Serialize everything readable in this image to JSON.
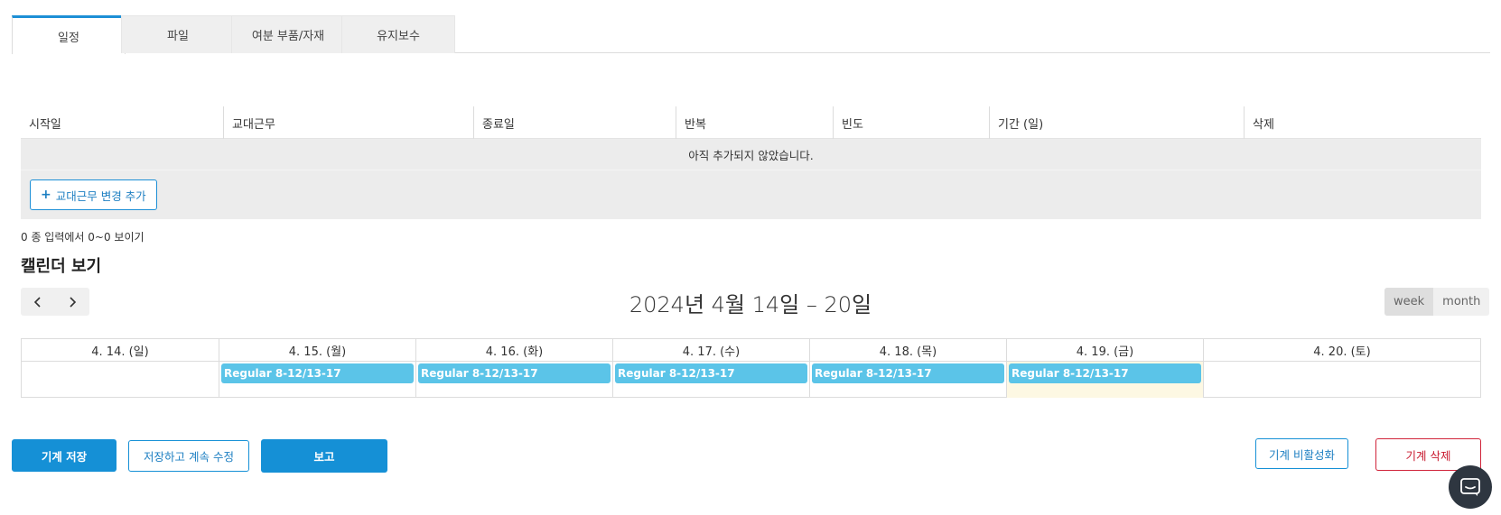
{
  "tabs": [
    {
      "label": "일정",
      "active": true
    },
    {
      "label": "파일",
      "active": false
    },
    {
      "label": "여분 부품/자재",
      "active": false
    },
    {
      "label": "유지보수",
      "active": false
    }
  ],
  "shift_table": {
    "columns": [
      "시작일",
      "교대근무",
      "종료일",
      "반복",
      "빈도",
      "기간 (일)",
      "삭제"
    ],
    "empty_message": "아직 추가되지 않았습니다.",
    "add_button_label": "교대근무 변경 추가",
    "entries_text": "0 종 입력에서 0~0 보이기"
  },
  "calendar": {
    "title": "캘린더 보기",
    "range_title": "2024년 4월 14일 – 20일",
    "views": [
      {
        "label": "week",
        "active": true
      },
      {
        "label": "month",
        "active": false
      }
    ],
    "days": [
      {
        "label": "4. 14. (일)",
        "event": null,
        "today": false
      },
      {
        "label": "4. 15. (월)",
        "event": "Regular 8-12/13-17",
        "today": false
      },
      {
        "label": "4. 16. (화)",
        "event": "Regular 8-12/13-17",
        "today": false
      },
      {
        "label": "4. 17. (수)",
        "event": "Regular 8-12/13-17",
        "today": false
      },
      {
        "label": "4. 18. (목)",
        "event": "Regular 8-12/13-17",
        "today": false
      },
      {
        "label": "4. 19. (금)",
        "event": "Regular 8-12/13-17",
        "today": true
      },
      {
        "label": "4. 20. (토)",
        "event": null,
        "today": false
      }
    ]
  },
  "actions": {
    "save": "기계 저장",
    "save_continue": "저장하고 계속 수정",
    "report": "보고",
    "deactivate": "기계 비활성화",
    "delete": "기계 삭제"
  },
  "colors": {
    "accent": "#1590d6",
    "event": "#5bc4e8",
    "danger": "#d0243a",
    "today": "#fdf8e3"
  }
}
